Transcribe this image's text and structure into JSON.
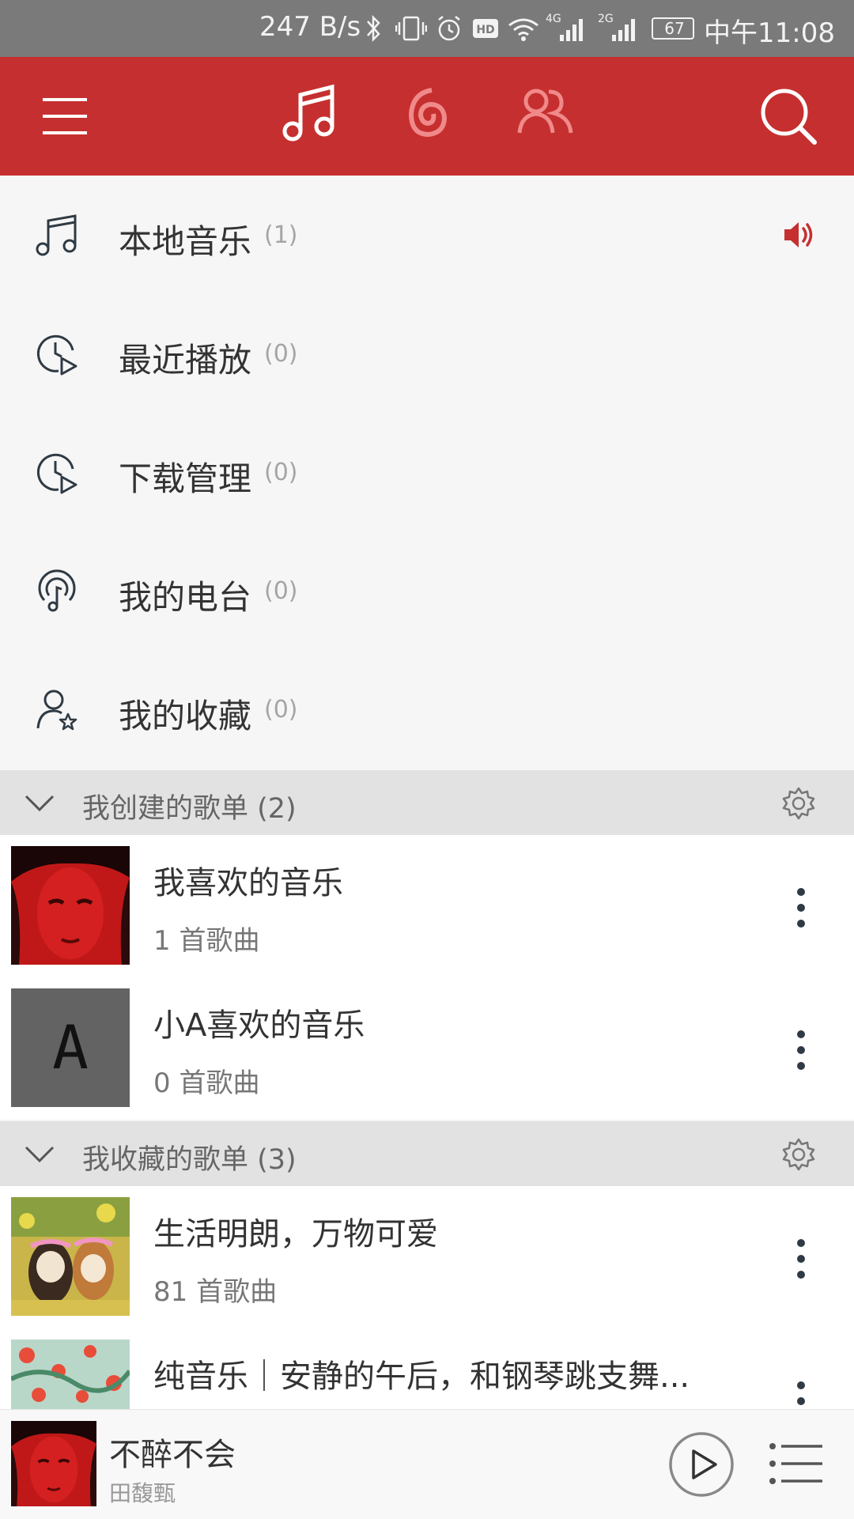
{
  "status_bar": {
    "net_speed": "247 B/s",
    "network_1": "4G",
    "network_2": "2G",
    "battery": "67",
    "time": "中午11:08"
  },
  "top_nav": {
    "icons": [
      "menu-icon",
      "music-note-icon",
      "netease-logo-icon",
      "friends-icon",
      "search-icon"
    ]
  },
  "menu": {
    "items": [
      {
        "label": "本地音乐",
        "count": "(1)",
        "icon": "music-note-icon"
      },
      {
        "label": "最近播放",
        "count": "(0)",
        "icon": "recent-play-icon"
      },
      {
        "label": "下载管理",
        "count": "(0)",
        "icon": "download-manage-icon"
      },
      {
        "label": "我的电台",
        "count": "(0)",
        "icon": "radio-icon"
      },
      {
        "label": "我的收藏",
        "count": "(0)",
        "icon": "user-star-icon"
      }
    ]
  },
  "created_playlists": {
    "header": "我创建的歌单 (2)",
    "items": [
      {
        "title": "我喜欢的音乐",
        "subtitle": "1 首歌曲"
      },
      {
        "title": "小A喜欢的音乐",
        "subtitle": "0 首歌曲",
        "cover_letter": "A"
      }
    ]
  },
  "collected_playlists": {
    "header": "我收藏的歌单 (3)",
    "items": [
      {
        "title": "生活明朗，万物可爱",
        "subtitle": "81 首歌曲"
      },
      {
        "title": "纯音乐｜安静的午后，和钢琴跳支舞...",
        "subtitle": ""
      }
    ]
  },
  "player": {
    "title": "不醉不会",
    "artist": "田馥甄"
  },
  "colors": {
    "brand_red": "#c62f2f",
    "status_bar": "#7a7a7a",
    "section_header": "#e2e2e2"
  }
}
